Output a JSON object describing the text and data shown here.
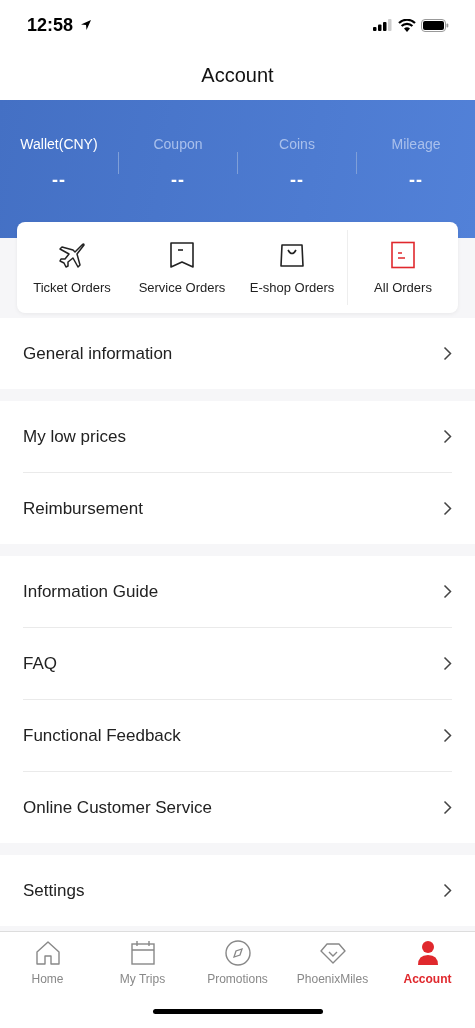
{
  "status_bar": {
    "time": "12:58"
  },
  "header": {
    "title": "Account"
  },
  "assets": [
    {
      "label": "Wallet(CNY)",
      "value": "--",
      "selected": true
    },
    {
      "label": "Coupon",
      "value": "--",
      "selected": false
    },
    {
      "label": "Coins",
      "value": "--",
      "selected": false
    },
    {
      "label": "Mileage",
      "value": "--",
      "selected": false
    }
  ],
  "orders": [
    {
      "kind": "plane",
      "label": "Ticket Orders"
    },
    {
      "kind": "bookmark",
      "label": "Service Orders"
    },
    {
      "kind": "bag",
      "label": "E-shop Orders"
    },
    {
      "kind": "list",
      "label": "All Orders"
    }
  ],
  "sections": [
    [
      "General information"
    ],
    [
      "My low prices",
      "Reimbursement"
    ],
    [
      "Information Guide",
      "FAQ",
      "Functional Feedback",
      "Online Customer Service"
    ],
    [
      "Settings"
    ]
  ],
  "tab_bar": [
    {
      "kind": "home",
      "label": "Home",
      "selected": false
    },
    {
      "kind": "calendar",
      "label": "My Trips",
      "selected": false
    },
    {
      "kind": "compass",
      "label": "Promotions",
      "selected": false
    },
    {
      "kind": "diamond",
      "label": "PhoenixMiles",
      "selected": false
    },
    {
      "kind": "person",
      "label": "Account",
      "selected": true
    }
  ]
}
